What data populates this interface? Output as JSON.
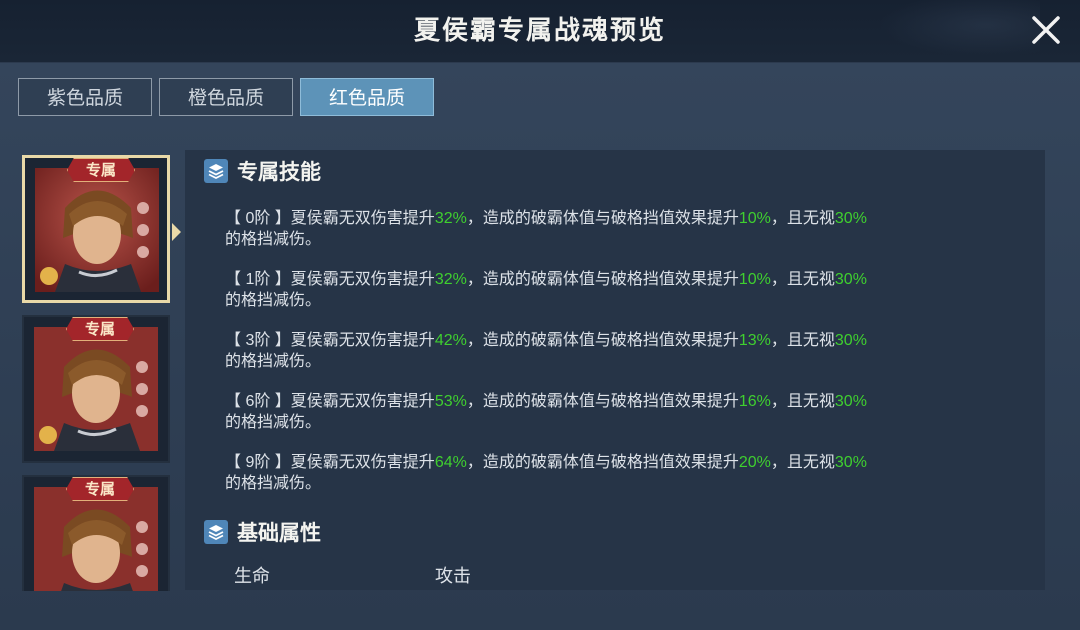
{
  "window": {
    "title": "夏侯霸专属战魂预览",
    "close_icon": "close-icon"
  },
  "tabs": [
    {
      "label": "紫色品质",
      "active": false
    },
    {
      "label": "橙色品质",
      "active": false
    },
    {
      "label": "红色品质",
      "active": true
    }
  ],
  "hero_cards": [
    {
      "badge": "专属",
      "selected": true
    },
    {
      "badge": "专属",
      "selected": false
    },
    {
      "badge": "专属",
      "selected": false
    }
  ],
  "exclusive_skill": {
    "heading": "专属技能",
    "tiers": [
      {
        "tier": "【 0阶 】",
        "t1": "夏侯霸无双伤害提升",
        "v1": "32%",
        "t2": "，造成的破霸体值与破格挡值效果提升",
        "v2": "10%",
        "t3": "，且无视",
        "v3": "30%",
        "t4": "的格挡减伤。"
      },
      {
        "tier": "【 1阶 】",
        "t1": "夏侯霸无双伤害提升",
        "v1": "32%",
        "t2": "，造成的破霸体值与破格挡值效果提升",
        "v2": "10%",
        "t3": "，且无视",
        "v3": "30%",
        "t4": "的格挡减伤。"
      },
      {
        "tier": "【 3阶 】",
        "t1": "夏侯霸无双伤害提升",
        "v1": "42%",
        "t2": "，造成的破霸体值与破格挡值效果提升",
        "v2": "13%",
        "t3": "，且无视",
        "v3": "30%",
        "t4": "的格挡减伤。"
      },
      {
        "tier": "【 6阶 】",
        "t1": "夏侯霸无双伤害提升",
        "v1": "53%",
        "t2": "，造成的破霸体值与破格挡值效果提升",
        "v2": "16%",
        "t3": "，且无视",
        "v3": "30%",
        "t4": "的格挡减伤。"
      },
      {
        "tier": "【 9阶 】",
        "t1": "夏侯霸无双伤害提升",
        "v1": "64%",
        "t2": "，造成的破霸体值与破格挡值效果提升",
        "v2": "20%",
        "t3": "，且无视",
        "v3": "30%",
        "t4": "的格挡减伤。"
      }
    ]
  },
  "base_attributes": {
    "heading": "基础属性",
    "labels": [
      "生命",
      "攻击"
    ]
  },
  "colors": {
    "highlight_green": "#3fcf2f",
    "active_tab": "#5d93b8",
    "badge_red": "#a3252a"
  }
}
